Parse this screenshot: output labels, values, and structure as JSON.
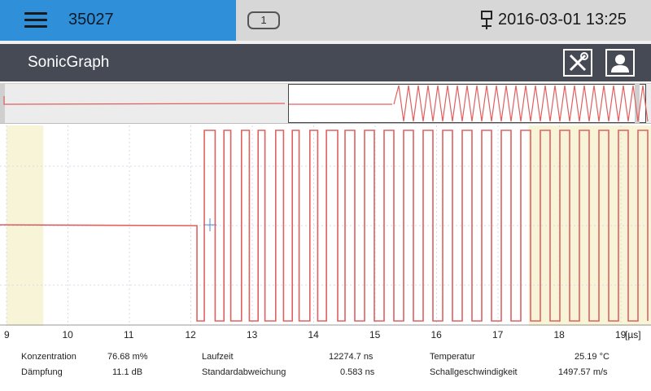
{
  "topbar": {
    "device_id": "35027",
    "message_count": "1",
    "datetime": "2016-03-01 13:25"
  },
  "titlebar": {
    "title": "SonicGraph"
  },
  "icons": {
    "menu": "hamburger-menu-icon",
    "network": "network-icon",
    "tools": "tools-icon",
    "user": "user-icon"
  },
  "colors": {
    "accent": "#2f8fd8",
    "titlebar": "#454a55",
    "signal": "#e06060",
    "highlight": "#f7f4d8"
  },
  "chart_data": {
    "type": "line",
    "x_ticks": [
      "9",
      "10",
      "11",
      "12",
      "13",
      "14",
      "15",
      "16",
      "17",
      "18",
      "19"
    ],
    "x_unit": "[µs]",
    "xlim": [
      9,
      19.5
    ],
    "grid": true,
    "highlight_regions": [
      [
        9,
        9.6
      ],
      [
        17.5,
        19.5
      ]
    ],
    "signal_description": "flat baseline until about 12.1 µs, then square-wave oscillation"
  },
  "measurements": [
    {
      "label": "Konzentration",
      "value": "76.68 m%"
    },
    {
      "label": "Dämpfung",
      "value": "11.1 dB"
    },
    {
      "label": "Laufzeit",
      "value": "12274.7 ns"
    },
    {
      "label": "Standardabweichung",
      "value": "0.583 ns"
    },
    {
      "label": "Temperatur",
      "value": "25.19 °C"
    },
    {
      "label": "Schallgeschwindigkeit",
      "value": "1497.57 m/s"
    }
  ]
}
